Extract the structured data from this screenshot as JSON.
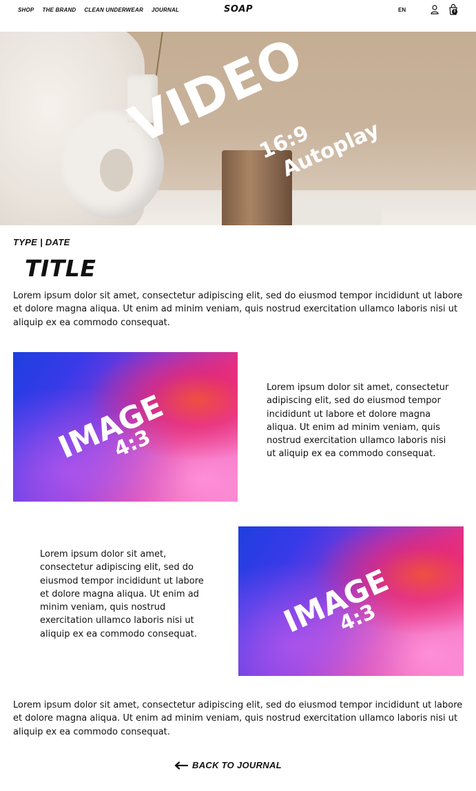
{
  "nav": {
    "items": [
      {
        "label": "SHOP"
      },
      {
        "label": "THE BRAND"
      },
      {
        "label": "CLEAN UNDERWEAR"
      },
      {
        "label": "JOURNAL"
      }
    ],
    "logo": "SOAP",
    "language": "EN",
    "cart_count": "0",
    "icons": {
      "account": "user-icon",
      "cart": "shopping-bag-icon"
    }
  },
  "hero": {
    "label_main": "VIDEO",
    "label_ratio": "16:9",
    "label_mode": "Autoplay"
  },
  "article": {
    "meta": "TYPE  |  DATE",
    "title": "TITLE",
    "intro": "Lorem ipsum dolor sit amet, consectetur adipiscing elit, sed do eiusmod tempor incididunt ut labore et dolore magna aliqua. Ut enim ad minim veniam, quis nostrud exercitation ullamco laboris nisi ut aliquip ex ea commodo consequat.",
    "block1": {
      "image_label": "IMAGE",
      "image_ratio": "4:3",
      "text": "Lorem ipsum dolor sit amet, consectetur adipiscing elit, sed do eiusmod tempor incididunt ut labore et dolore magna aliqua. Ut enim ad minim veniam, quis nostrud exercitation ullamco laboris nisi ut aliquip ex ea commodo consequat."
    },
    "block2": {
      "image_label": "IMAGE",
      "image_ratio": "4:3",
      "text": "Lorem ipsum dolor sit amet, consectetur adipiscing elit, sed do eiusmod tempor incididunt ut labore et dolore magna aliqua. Ut enim ad minim veniam, quis nostrud exercitation ullamco laboris nisi ut aliquip ex ea commodo consequat."
    },
    "outro": "Lorem ipsum dolor sit amet, consectetur adipiscing elit, sed do eiusmod tempor incididunt ut labore et dolore magna aliqua. Ut enim ad minim veniam, quis nostrud exercitation ullamco laboris nisi ut aliquip ex ea commodo consequat."
  },
  "footer": {
    "back_label": "BACK TO JOURNAL",
    "back_icon": "arrow-left-icon"
  }
}
